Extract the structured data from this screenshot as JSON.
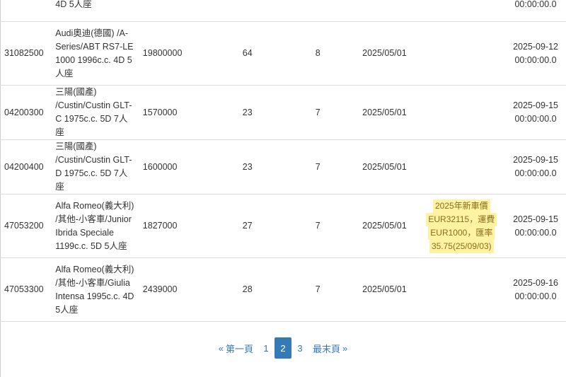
{
  "rows": [
    {
      "code": "",
      "name": "4D 5人座",
      "price": "",
      "n1": "",
      "n2": "",
      "date": "",
      "note": [],
      "updated": [
        "",
        "00:00:00.0"
      ]
    },
    {
      "code": "31082500",
      "name": "Audi奧迪(德國) /A-Series/ABT RS7-LE 1000 1996c.c. 4D 5人座",
      "price": "19800000",
      "n1": "64",
      "n2": "8",
      "date": "2025/05/01",
      "note": [],
      "updated": [
        "2025-09-12",
        "00:00:00.0"
      ]
    },
    {
      "code": "04200300",
      "name": "三陽(國產) /Custin/Custin GLT-C 1975c.c. 5D 7人座",
      "price": "1570000",
      "n1": "23",
      "n2": "7",
      "date": "2025/05/01",
      "note": [],
      "updated": [
        "2025-09-15",
        "00:00:00.0"
      ]
    },
    {
      "code": "04200400",
      "name": "三陽(國產) /Custin/Custin GLT-D 1975c.c. 5D 7人座",
      "price": "1600000",
      "n1": "23",
      "n2": "7",
      "date": "2025/05/01",
      "note": [],
      "updated": [
        "2025-09-15",
        "00:00:00.0"
      ]
    },
    {
      "code": "47053200",
      "name": "Alfa Romeo(義大利) /其他-小客車/Junior Ibrida Speciale 1199c.c. 5D 5人座",
      "price": "1827000",
      "n1": "27",
      "n2": "7",
      "date": "2025/05/01",
      "note": [
        "2025年新車價",
        "EUR32115，運費",
        "EUR1000，匯率",
        "35.75(25/09/03)"
      ],
      "updated": [
        "2025-09-15",
        "00:00:00.0"
      ]
    },
    {
      "code": "47053300",
      "name": "Alfa Romeo(義大利) /其他-小客車/Giulia Intensa 1995c.c. 4D 5人座",
      "price": "2439000",
      "n1": "28",
      "n2": "7",
      "date": "2025/05/01",
      "note": [],
      "updated": [
        "2025-09-16",
        "00:00:00.0"
      ]
    }
  ],
  "pagination": {
    "first_icon": "double-chevron-left-icon",
    "first_label": "第一頁",
    "pages": [
      "1",
      "2",
      "3"
    ],
    "current": "2",
    "last_label": "最末頁",
    "last_icon": "double-chevron-right-icon",
    "first_glyph": "«",
    "last_glyph": "»"
  }
}
